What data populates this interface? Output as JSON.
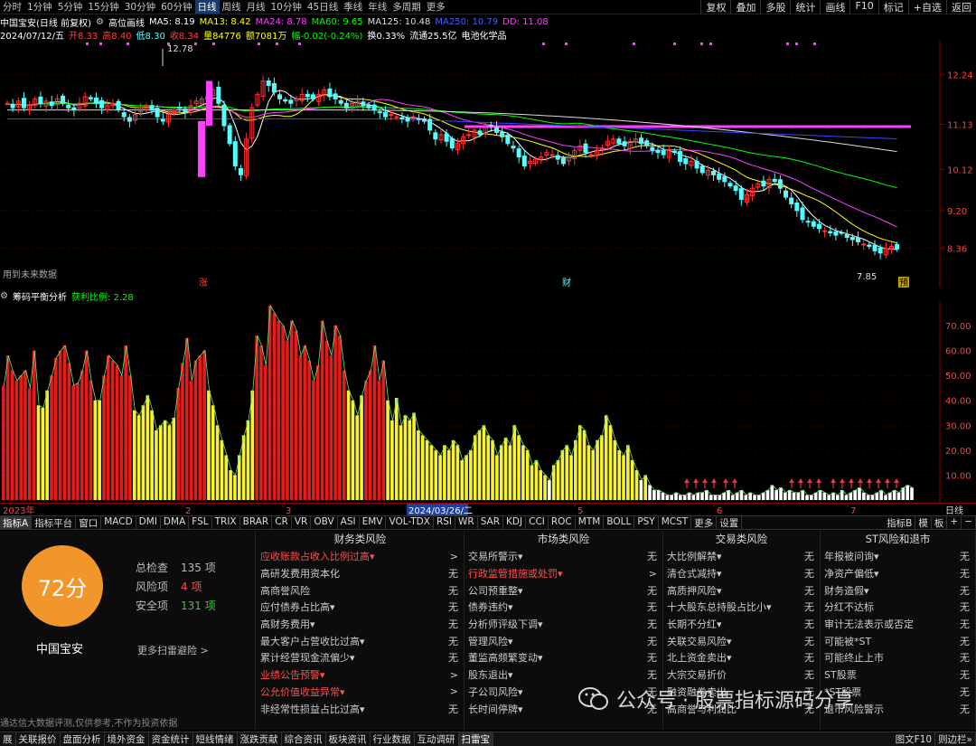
{
  "colors": {
    "up": "#ff3232",
    "down": "#54ffff",
    "ma5": "#ffffff",
    "ma13": "#ffff00",
    "ma24": "#ff40ff",
    "ma60": "#00ff00",
    "ma125": "#dcdcdc",
    "ma250": "#4040ff",
    "accent": "#f0962a",
    "red_bar": "#e31c1c",
    "yellow_bar": "#f7f330",
    "white_bar": "#ffffff"
  },
  "period_bar": {
    "items": [
      "分时",
      "1分钟",
      "5分钟",
      "15分钟",
      "30分钟",
      "60分钟",
      "日线",
      "周线",
      "月线",
      "10分钟",
      "45日线",
      "季线",
      "年线",
      "多周期",
      "更多"
    ],
    "active": "日线",
    "right_buttons": [
      "复权",
      "叠加",
      "多股",
      "统计",
      "画线",
      "F10",
      "标记",
      "+自选",
      "返回"
    ]
  },
  "ma_line": {
    "name": "中国宝安(日线 前复权)",
    "indicator": "高位画线",
    "ma5": "MA5: 8.19",
    "ma13": "MA13: 8.42",
    "ma24": "MA24: 8.78",
    "ma60": "MA60: 9.65",
    "ma125": "MA125: 10.48",
    "ma250": "MA250: 10.79",
    "dd": "DD: 11.08"
  },
  "quote_line": {
    "date": "2024/07/12/五",
    "open": "开8.33",
    "high": "高8.40",
    "low": "低8.30",
    "close": "收8.34",
    "volume": "量84776",
    "amount": "额7081万",
    "change": "幅-0.02(-0.24%)",
    "turnover": "换0.33%",
    "float": "流通25.5亿",
    "sector": "电池化学品"
  },
  "kchart": {
    "price_labels": [
      "12.24",
      "11.13",
      "10.12",
      "9.20",
      "8.36"
    ],
    "high_label": "12.78",
    "low_label": "7.85",
    "note": "用到未来数据",
    "markers": [
      "涨",
      "财",
      "预"
    ]
  },
  "ind_line": {
    "name": "筹码平衡分析",
    "label": "获利比例: 2.28"
  },
  "volchart": {
    "labels": [
      "70.00",
      "60.00",
      "50.00",
      "40.00",
      "30.00",
      "20.00",
      "10.00"
    ]
  },
  "axis": {
    "year": "2023年",
    "months": [
      "2",
      "3",
      "5",
      "6",
      "7"
    ],
    "cursor_date": "2024/03/26/二",
    "right": "日线"
  },
  "ind_tabs": {
    "items": [
      "指标A",
      "指标平台",
      "窗口",
      "MACD",
      "DMI",
      "DMA",
      "FSL",
      "TRIX",
      "BRAR",
      "CR",
      "VR",
      "OBV",
      "ASI",
      "EMV",
      "VOL-TDX",
      "RSI",
      "WR",
      "SAR",
      "KDJ",
      "CCI",
      "ROC",
      "MTM",
      "BOLL",
      "PSY",
      "MCST",
      "更多",
      "设置"
    ],
    "active": "指标A",
    "right": [
      "指标B",
      "模",
      "板",
      "+",
      "−"
    ]
  },
  "scan": {
    "score": "72分",
    "name": "中国宝安",
    "stats": [
      {
        "label": "总检查",
        "value": "135 项"
      },
      {
        "label": "风险项",
        "value": "4 项"
      },
      {
        "label": "安全项",
        "value": "131 项"
      }
    ],
    "more": "更多扫雷避险 >",
    "disclaimer": "通达信大数据评测,仅供参考,不作为投资依据",
    "categories": [
      {
        "title": "财务类风险",
        "rows": [
          {
            "label": "应收账款占收入比例过高▾",
            "value": ">",
            "warn": true
          },
          {
            "label": "高研发费用资本化",
            "value": "无"
          },
          {
            "label": "高商誉风险",
            "value": "无"
          },
          {
            "label": "应付债券占比高▾",
            "value": "无"
          },
          {
            "label": "高财务费用▾",
            "value": "无"
          },
          {
            "label": "最大客户占营收比过高▾",
            "value": "无"
          },
          {
            "label": "累计经营现金流偏少▾",
            "value": "无"
          },
          {
            "label": "业绩公告预警▾",
            "value": ">",
            "warn": true
          },
          {
            "label": "公允价值收益异常▾",
            "value": ">",
            "warn": true
          },
          {
            "label": "非经常性损益占比过高▾",
            "value": "无"
          }
        ]
      },
      {
        "title": "市场类风险",
        "rows": [
          {
            "label": "交易所警示▾",
            "value": "无"
          },
          {
            "label": "行政监管措施或处罚▾",
            "value": ">",
            "warn": true
          },
          {
            "label": "公司预重整▾",
            "value": "无"
          },
          {
            "label": "债券违约▾",
            "value": "无"
          },
          {
            "label": "分析师评级下调▾",
            "value": "无"
          },
          {
            "label": "管理风险▾",
            "value": "无"
          },
          {
            "label": "董监高频繁变动▾",
            "value": "无"
          },
          {
            "label": "股东退出▾",
            "value": "无"
          },
          {
            "label": "子公司风险▾",
            "value": "无"
          },
          {
            "label": "长时间停牌▾",
            "value": "无"
          }
        ]
      },
      {
        "title": "交易类风险",
        "rows": [
          {
            "label": "大比例解禁▾",
            "value": "无"
          },
          {
            "label": "清仓式减持▾",
            "value": "无"
          },
          {
            "label": "高质押风险▾",
            "value": "无"
          },
          {
            "label": "十大股东总持股占比小▾",
            "value": "无"
          },
          {
            "label": "长期不分红▾",
            "value": "无"
          },
          {
            "label": "关联交易风险▾",
            "value": "无"
          },
          {
            "label": "北上资金卖出▾",
            "value": "无"
          },
          {
            "label": "大宗交易折价",
            "value": "无"
          },
          {
            "label": "融资融券卖出",
            "value": "无"
          },
          {
            "label": "高商誉与利润比",
            "value": "无"
          }
        ]
      },
      {
        "title": "ST风险和退市",
        "rows": [
          {
            "label": "年报被问询▾",
            "value": "无"
          },
          {
            "label": "净资产偏低▾",
            "value": "无"
          },
          {
            "label": "财务造假▾",
            "value": "无"
          },
          {
            "label": "分红不达标",
            "value": "无"
          },
          {
            "label": "审计无法表示或否定",
            "value": "无"
          },
          {
            "label": "可能被*ST",
            "value": "无"
          },
          {
            "label": "可能终止上市",
            "value": "无"
          },
          {
            "label": "ST股票",
            "value": "无"
          },
          {
            "label": "*ST股票",
            "value": "无"
          },
          {
            "label": "退市风险警示",
            "value": "无"
          }
        ]
      }
    ]
  },
  "watermark": "公众号 · 股票指标源码分享",
  "bottom_bar": {
    "items": [
      "展",
      "关联报价",
      "盘面分析",
      "境外资金",
      "资金统计",
      "短线情绪",
      "涨跌贡献",
      "综合资讯",
      "板块资讯",
      "行业数据",
      "互动调研",
      "扫雷宝"
    ],
    "active": "扫雷宝",
    "right": [
      "图文F10",
      "则边栏»"
    ]
  },
  "chart_data": [
    {
      "type": "candlestick",
      "title": "中国宝安(日线 前复权)",
      "y_labels": [
        12.24,
        11.13,
        10.12,
        9.2,
        8.36
      ],
      "close": [
        11.6,
        11.5,
        11.65,
        11.5,
        11.55,
        11.7,
        11.6,
        11.65,
        11.55,
        11.7,
        11.6,
        11.5,
        11.45,
        11.6,
        11.75,
        11.7,
        11.6,
        11.5,
        11.55,
        11.6,
        11.45,
        11.3,
        11.2,
        11.35,
        11.5,
        11.55,
        11.45,
        11.3,
        11.2,
        11.35,
        11.45,
        11.5,
        11.4,
        11.55,
        11.65,
        11.7,
        11.75,
        11.9,
        11.6,
        11.1,
        10.7,
        10.2,
        10.0,
        10.8,
        11.5,
        11.8,
        12.1,
        12.0,
        11.85,
        11.7,
        11.65,
        11.6,
        11.7,
        11.8,
        11.75,
        11.7,
        11.8,
        11.9,
        11.75,
        11.7,
        11.6,
        11.5,
        11.6,
        11.65,
        11.55,
        11.5,
        11.45,
        11.4,
        11.3,
        11.35,
        11.3,
        11.25,
        11.2,
        11.3,
        11.25,
        11.2,
        11.0,
        10.8,
        10.9,
        10.75,
        10.6,
        10.7,
        10.85,
        10.9,
        11.0,
        10.9,
        11.05,
        11.1,
        10.95,
        10.85,
        10.7,
        10.6,
        10.4,
        10.2,
        10.3,
        10.35,
        10.4,
        10.5,
        10.45,
        10.35,
        10.25,
        10.4,
        10.55,
        10.65,
        10.5,
        10.45,
        10.55,
        10.6,
        10.75,
        10.8,
        10.7,
        10.65,
        10.75,
        10.8,
        10.7,
        10.65,
        10.55,
        10.5,
        10.45,
        10.55,
        10.5,
        10.3,
        10.25,
        10.3,
        10.15,
        10.05,
        10.1,
        10.0,
        9.9,
        9.85,
        9.75,
        9.65,
        9.45,
        9.55,
        9.7,
        9.8,
        9.75,
        9.9,
        9.85,
        9.7,
        9.5,
        9.35,
        9.2,
        9.0,
        8.95,
        8.85,
        8.8,
        8.75,
        8.7,
        8.65,
        8.7,
        8.6,
        8.55,
        8.5,
        8.45,
        8.4,
        8.3,
        8.25,
        8.35,
        8.4,
        8.34
      ],
      "high": 12.78,
      "low": 7.85,
      "series": [
        {
          "name": "MA5",
          "last": 8.19
        },
        {
          "name": "MA13",
          "last": 8.42
        },
        {
          "name": "MA24",
          "last": 8.78
        },
        {
          "name": "MA60",
          "last": 9.65
        },
        {
          "name": "MA125",
          "last": 10.48
        },
        {
          "name": "MA250",
          "last": 10.79
        },
        {
          "name": "DD",
          "last": 11.08
        }
      ]
    },
    {
      "type": "bar",
      "title": "筹码平衡分析",
      "ylim": [
        0,
        78
      ],
      "values": [
        46,
        58,
        52,
        48,
        50,
        52,
        45,
        60,
        38,
        37,
        44,
        50,
        57,
        60,
        62,
        55,
        46,
        47,
        52,
        60,
        48,
        40,
        40,
        50,
        58,
        56,
        54,
        50,
        62,
        50,
        36,
        34,
        38,
        42,
        36,
        28,
        30,
        32,
        30,
        33,
        45,
        55,
        65,
        48,
        56,
        58,
        60,
        44,
        38,
        30,
        24,
        18,
        12,
        10,
        18,
        26,
        32,
        44,
        66,
        62,
        54,
        78,
        75,
        72,
        70,
        64,
        72,
        68,
        58,
        62,
        56,
        48,
        54,
        72,
        64,
        58,
        70,
        66,
        52,
        44,
        40,
        34,
        42,
        48,
        52,
        62,
        48,
        56,
        40,
        32,
        41,
        30,
        34,
        32,
        35,
        28,
        26,
        24,
        22,
        20,
        18,
        22,
        20,
        24,
        22,
        16,
        18,
        20,
        26,
        28,
        30,
        26,
        24,
        18,
        22,
        25,
        22,
        30,
        26,
        22,
        20,
        14,
        16,
        12,
        10,
        8,
        14,
        16,
        20,
        22,
        18,
        24,
        30,
        28,
        22,
        20,
        24,
        26,
        34,
        30,
        24,
        20,
        18,
        22,
        16,
        12,
        8,
        10,
        6,
        4,
        4,
        3,
        2,
        2,
        3,
        2,
        2,
        3,
        2,
        3,
        3,
        4,
        2,
        2,
        2,
        3,
        4,
        2,
        3,
        4,
        2,
        3,
        2,
        2,
        3,
        4,
        6,
        4,
        5,
        3,
        4,
        3,
        3,
        4,
        2,
        2,
        3,
        4,
        3,
        2,
        3,
        2,
        4,
        2,
        3,
        4,
        5,
        3,
        2,
        2,
        3,
        4,
        2,
        3,
        4,
        3,
        5,
        6,
        5
      ]
    }
  ]
}
